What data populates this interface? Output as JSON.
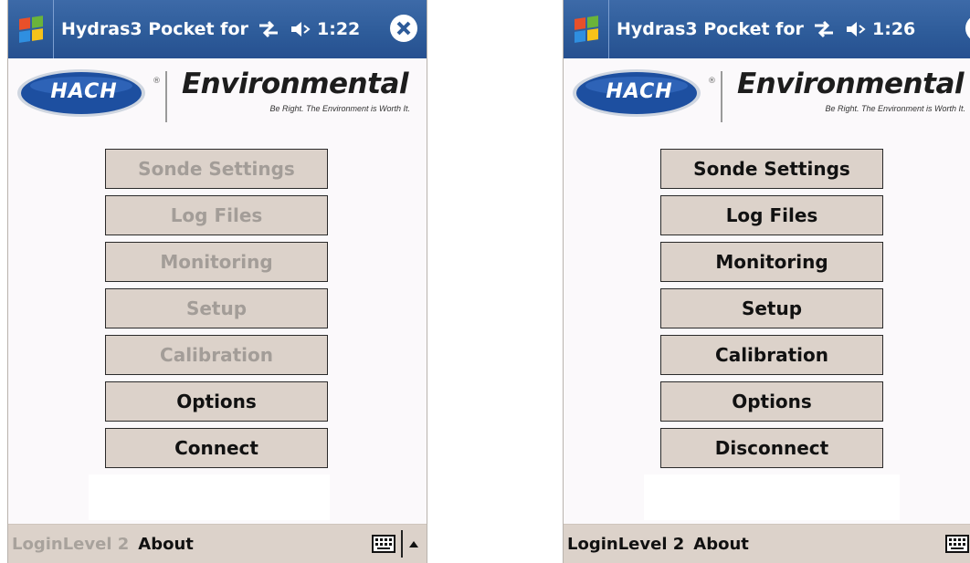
{
  "screens": [
    {
      "id": "left",
      "title": "Hydras3 Pocket for",
      "time": "1:22",
      "logo": {
        "hach": "HACH",
        "env": "Environmental",
        "tagline": "Be Right. The Environment is Worth It."
      },
      "buttons": [
        {
          "label": "Sonde Settings",
          "enabled": false
        },
        {
          "label": "Log Files",
          "enabled": false
        },
        {
          "label": "Monitoring",
          "enabled": false
        },
        {
          "label": "Setup",
          "enabled": false
        },
        {
          "label": "Calibration",
          "enabled": false
        },
        {
          "label": "Options",
          "enabled": true
        },
        {
          "label": "Connect",
          "enabled": true
        }
      ],
      "softkeys": {
        "left": "LoginLevel 2",
        "left_enabled": false,
        "right": "About"
      }
    },
    {
      "id": "right",
      "title": "Hydras3 Pocket for",
      "time": "1:26",
      "logo": {
        "hach": "HACH",
        "env": "Environmental",
        "tagline": "Be Right. The Environment is Worth It."
      },
      "buttons": [
        {
          "label": "Sonde Settings",
          "enabled": true
        },
        {
          "label": "Log Files",
          "enabled": true
        },
        {
          "label": "Monitoring",
          "enabled": true
        },
        {
          "label": "Setup",
          "enabled": true
        },
        {
          "label": "Calibration",
          "enabled": true
        },
        {
          "label": "Options",
          "enabled": true
        },
        {
          "label": "Disconnect",
          "enabled": true
        }
      ],
      "softkeys": {
        "left": "LoginLevel 2",
        "left_enabled": true,
        "right": "About"
      }
    }
  ],
  "colors": {
    "titlebar": "#2d5b99",
    "button_bg": "#dcd2ca",
    "disabled_text": "#a39d98",
    "hach_blue": "#1d4fa0"
  },
  "icons": [
    "windows-start-icon",
    "connectivity-icon",
    "volume-icon",
    "close-icon",
    "keyboard-icon",
    "up-arrow-icon"
  ]
}
